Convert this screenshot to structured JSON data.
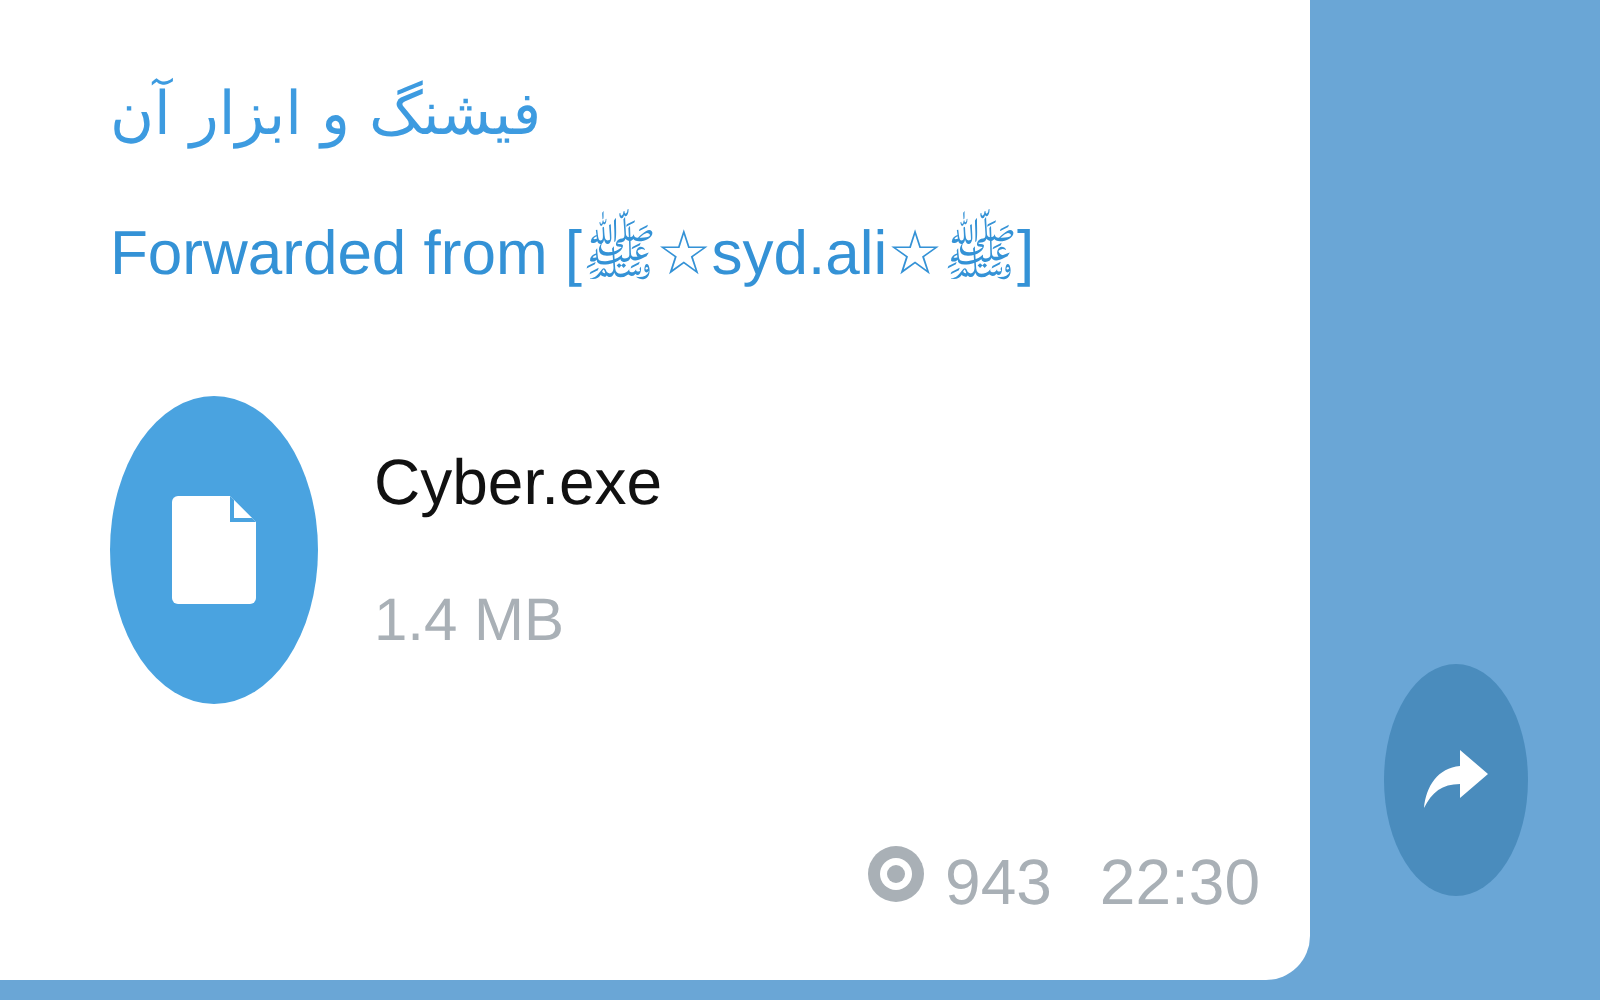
{
  "message": {
    "channel_title": "فیشنگ و ابزار آن",
    "forwarded": "Forwarded from [ﷺ☆syd.ali☆ﷺ]",
    "file": {
      "name": "Cyber.exe",
      "size": "1.4 MB"
    },
    "views": "943",
    "time": "22:30"
  }
}
